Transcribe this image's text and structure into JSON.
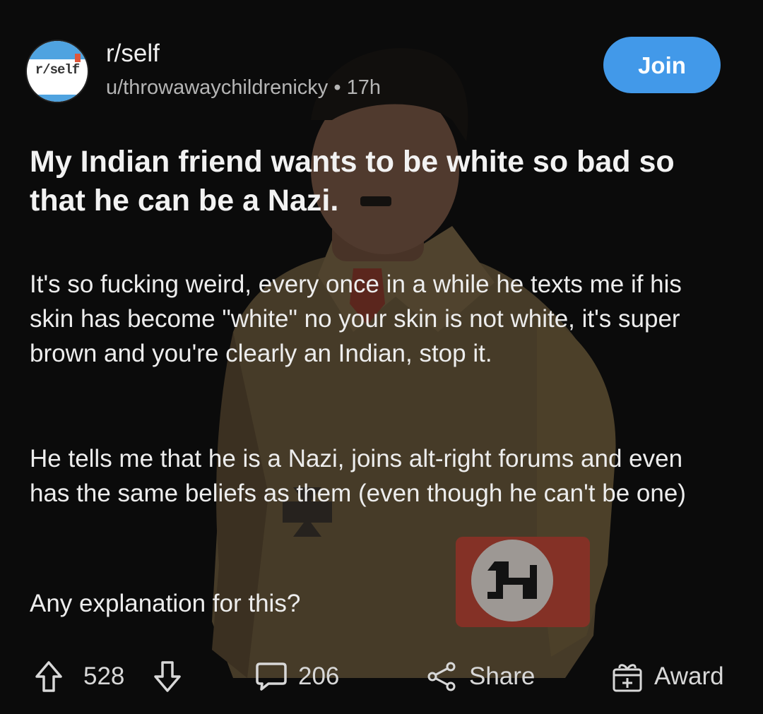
{
  "post": {
    "subreddit": "r/self",
    "avatar_text": "r/self",
    "author": "u/throwawaychildrenicky",
    "separator": "•",
    "age": "17h",
    "join_label": "Join",
    "title": "My Indian friend wants to be white so bad so that he can be a Nazi.",
    "body": [
      "It's so fucking weird, every once in a while he texts me if his skin has become \"white\" no your skin is not white, it's super brown and you're clearly an Indian, stop it.",
      "He tells me that he is a Nazi, joins alt-right forums and even has the same beliefs as them (even though he can't be one)",
      "Any explanation for this?"
    ]
  },
  "actions": {
    "score": "528",
    "comments": "206",
    "share_label": "Share",
    "award_label": "Award"
  },
  "icons": {
    "upvote": "upvote-arrow-icon",
    "downvote": "downvote-arrow-icon",
    "comments": "speech-bubble-icon",
    "share": "share-nodes-icon",
    "award": "gift-box-icon"
  },
  "colors": {
    "join_button": "#4299e9",
    "background": "#111111",
    "text": "#ededed",
    "meta": "#b5b5b5"
  }
}
